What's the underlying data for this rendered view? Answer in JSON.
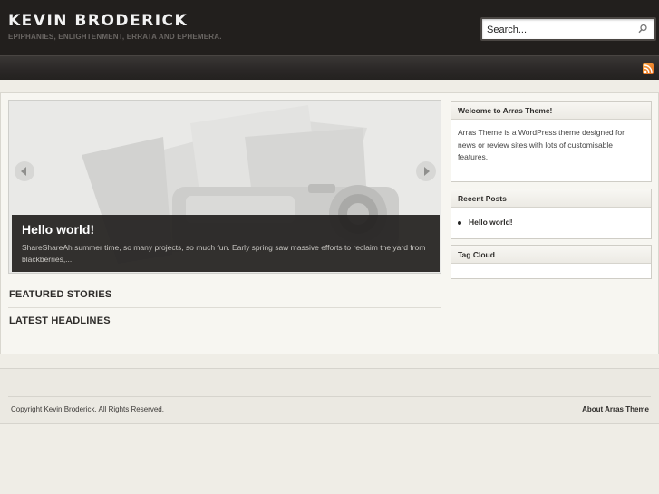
{
  "header": {
    "site_title": "KEVIN BRODERICK",
    "site_description": "EPIPHANIES, ENLIGHTENMENT, ERRATA AND EPHEMERA.",
    "search": {
      "placeholder": "Search...",
      "value": ""
    }
  },
  "navbar": {
    "rss_icon": "rss-icon"
  },
  "slider": {
    "post_title": "Hello world!",
    "post_excerpt": "ShareShareAh summer time, so many projects, so much fun.  Early spring saw massive efforts to reclaim the yard from blackberries,...",
    "prev_icon": "arrow-left-icon",
    "next_icon": "arrow-right-icon"
  },
  "sections": {
    "featured": "FEATURED STORIES",
    "latest": "LATEST HEADLINES"
  },
  "sidebar": {
    "welcome": {
      "title": "Welcome to Arras Theme!",
      "text": "Arras Theme is a WordPress theme designed for news or review sites with lots of customisable features."
    },
    "recent_posts": {
      "title": "Recent Posts",
      "items": [
        {
          "label": "Hello world!"
        }
      ]
    },
    "tag_cloud": {
      "title": "Tag Cloud"
    }
  },
  "footer": {
    "copyright": "Copyright Kevin Broderick. All Rights Reserved.",
    "about_link": "About Arras Theme"
  },
  "colors": {
    "header_bg": "#221f1d",
    "page_bg": "#efede6",
    "accent_rss": "#f08a2a"
  }
}
